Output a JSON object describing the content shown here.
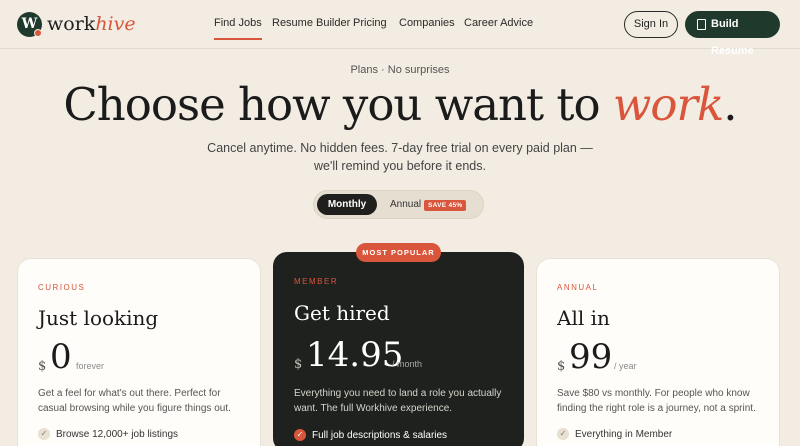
{
  "brand": {
    "mark": "W",
    "name_a": "work",
    "name_b": "hive"
  },
  "nav": {
    "links": [
      "Find Jobs",
      "Resume Builder",
      "Pricing",
      "Companies",
      "Career Advice"
    ],
    "active_index": 0,
    "sign_in": "Sign In",
    "build_resume": "Build Resume"
  },
  "hero": {
    "eyebrow": "Plans · No surprises",
    "headline_pre": "Choose how you want to ",
    "headline_accent": "work",
    "headline_post": ".",
    "subtitle": "Cancel anytime. No hidden fees. 7-day free trial on every paid plan — we'll remind you before it ends."
  },
  "billing_toggle": {
    "monthly": "Monthly",
    "annual": "Annual",
    "save_badge": "SAVE 45%",
    "selected": "Monthly"
  },
  "plans": [
    {
      "tier": "CURIOUS",
      "title": "Just looking",
      "currency": "$",
      "amount": "0",
      "period": "forever",
      "description": "Get a feel for what's out there. Perfect for casual browsing while you figure things out.",
      "feature": "Browse 12,000+ job listings"
    },
    {
      "tier": "MEMBER",
      "badge": "MOST POPULAR",
      "title": "Get hired",
      "currency": "$",
      "amount": "14.95",
      "period": "/ month",
      "description": "Everything you need to land a role you actually want. The full Workhive experience.",
      "feature": "Full job descriptions & salaries"
    },
    {
      "tier": "ANNUAL",
      "title": "All in",
      "currency": "$",
      "amount": "99",
      "period": "/ year",
      "description": "Save $80 vs monthly. For people who know finding the right role is a journey, not a sprint.",
      "feature": "Everything in Member"
    }
  ],
  "colors": {
    "background": "#f2ece2",
    "accent": "#d9553b",
    "brand_green": "#1f3a2c",
    "dark_card": "#1e211d"
  }
}
